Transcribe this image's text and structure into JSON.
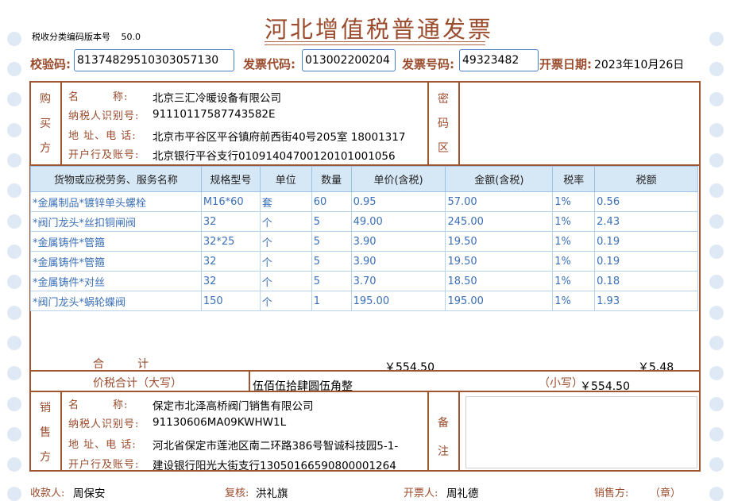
{
  "invoice": {
    "title": "河北增值税普通发票",
    "version_label": "税收分类编码版本号",
    "version_value": "50.0",
    "check_code_label": "校验码:",
    "check_code": "81374829510303057130",
    "invoice_code_label": "发票代码:",
    "invoice_code": "013002200204",
    "invoice_number_label": "发票号码:",
    "invoice_number": "49323482",
    "date_label": "开票日期:",
    "date": "2023年10月26日"
  },
  "buyer": {
    "section_label": [
      "购",
      "买",
      "方"
    ],
    "name_label": "名　　　称:",
    "name": "北京三汇冷暖设备有限公司",
    "tax_id_label": "纳税人识别号:",
    "tax_id": "91110117587743582E",
    "address_label": "地 址、电 话:",
    "address": "北京市平谷区平谷镇府前西街40号205室 18001317",
    "bank_label": "开户行及账号:",
    "bank": "北京银行平谷支行01091404700120101001056"
  },
  "cipher": {
    "section_label": [
      "密",
      "码",
      "区"
    ]
  },
  "items": {
    "headers": [
      "货物或应税劳务、服务名称",
      "规格型号",
      "单位",
      "数量",
      "单价(含税)",
      "金额(含税)",
      "税率",
      "税额"
    ],
    "rows": [
      [
        "*金属制品*镀锌单头螺栓",
        "M16*60",
        "套",
        "60",
        "0.95",
        "57.00",
        "1%",
        "0.56"
      ],
      [
        "*阀门龙头*丝扣铜闸阀",
        "32",
        "个",
        "5",
        "49.00",
        "245.00",
        "1%",
        "2.43"
      ],
      [
        "*金属铸件*管箍",
        "32*25",
        "个",
        "5",
        "3.90",
        "19.50",
        "1%",
        "0.19"
      ],
      [
        "*金属铸件*管箍",
        "32",
        "个",
        "5",
        "3.90",
        "19.50",
        "1%",
        "0.19"
      ],
      [
        "*金属铸件*对丝",
        "32",
        "个",
        "5",
        "3.70",
        "18.50",
        "1%",
        "0.18"
      ],
      [
        "*阀门龙头*蜗轮蝶阀",
        "150",
        "个",
        "1",
        "195.00",
        "195.00",
        "1%",
        "1.93"
      ]
    ]
  },
  "totals": {
    "subtotal_label": "合　　　计",
    "subtotal_amount": "￥554.50",
    "subtotal_tax": "￥5.48",
    "total_label": "价税合计（大写）",
    "total_upper": "伍佰伍拾肆圆伍角整",
    "total_small_label": "（小写）",
    "total_small": "￥554.50"
  },
  "seller": {
    "section_label": [
      "销",
      "售",
      "方"
    ],
    "name_label": "名　　　称:",
    "name": "保定市北泽高桥阀门销售有限公司",
    "tax_id_label": "纳税人识别号:",
    "tax_id": "91130606MA09KWHW1L",
    "address_label": "地 址、电 话:",
    "address": "河北省保定市莲池区南二环路386号智诚科技园5-1-",
    "bank_label": "开户行及账号:",
    "bank": "建设银行阳光大街支行13050166590800001264"
  },
  "remarks": {
    "section_label": [
      "备",
      "注"
    ]
  },
  "footer": {
    "payee_label": "收款人:",
    "payee": "周保安",
    "reviewer_label": "复核:",
    "reviewer": "洪礼旗",
    "drawer_label": "开票人:",
    "drawer": "周礼德",
    "seller_label": "销售方:",
    "seal": "（章）"
  },
  "colors": {
    "frame": "#a0552f",
    "label": "#9a4b2c",
    "item_text": "#3a6fb7",
    "header_bg": "#d6e7f6"
  }
}
